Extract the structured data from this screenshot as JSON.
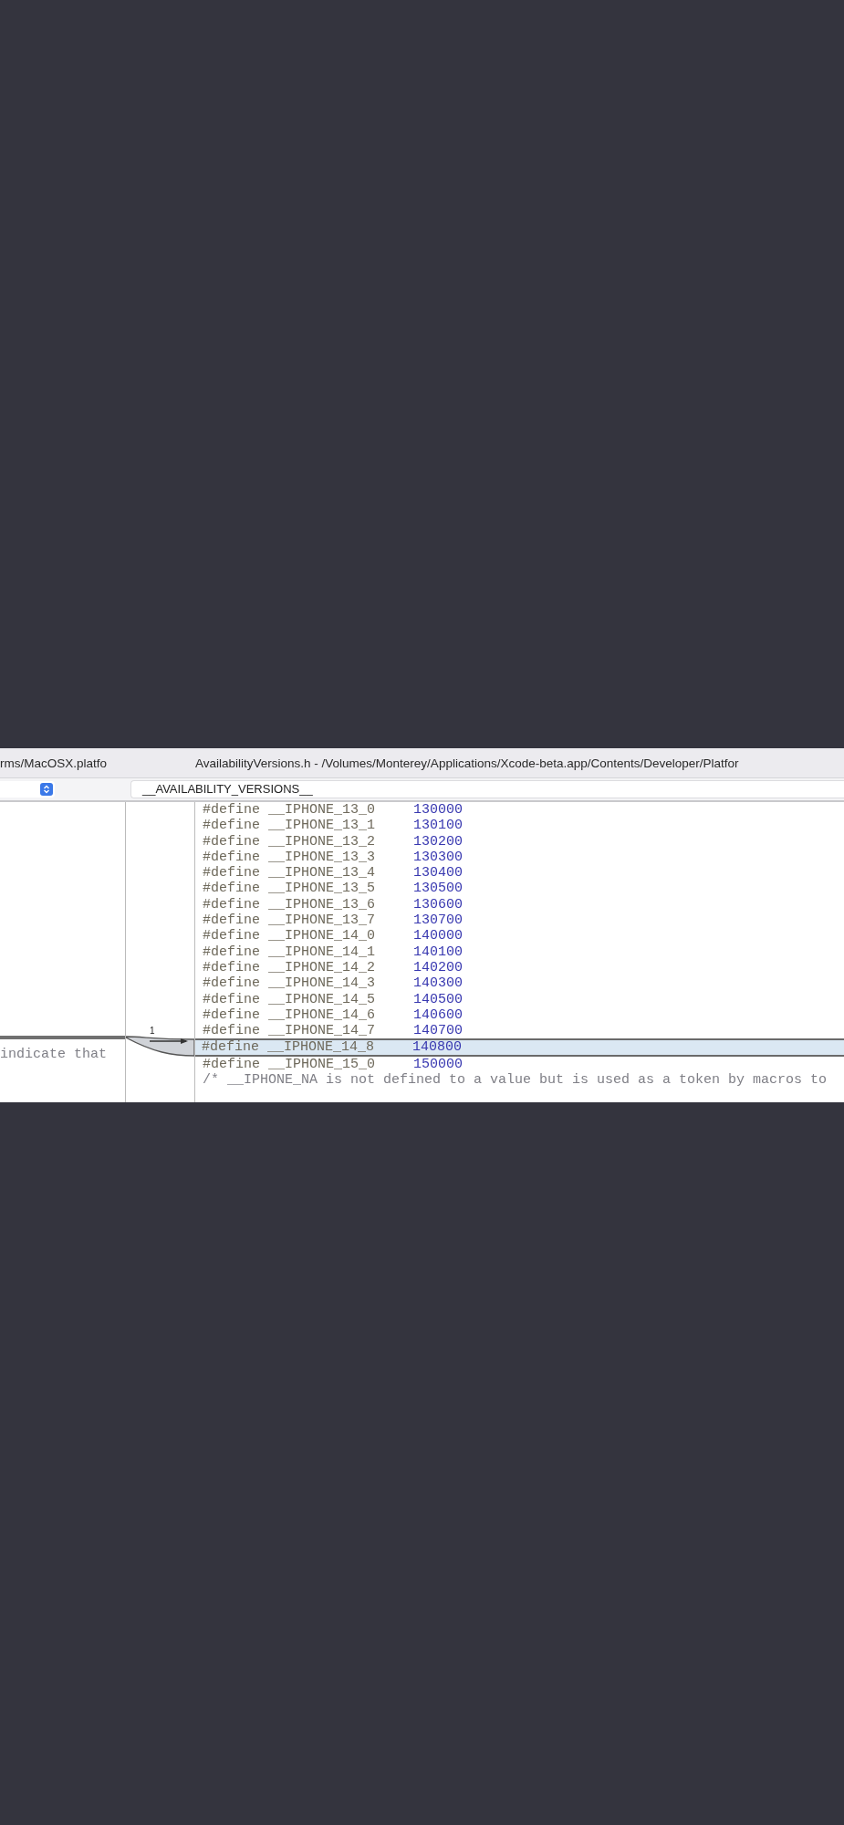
{
  "left_pane": {
    "title": "rms/MacOSX.platfo",
    "lines": [
      {
        "kind": "insertion_marker"
      },
      {
        "kind": "text",
        "text": " indicate that"
      }
    ]
  },
  "gutter": {
    "change_count": "1"
  },
  "right_pane": {
    "title": "AvailabilityVersions.h - /Volumes/Monterey/Applications/Xcode-beta.app/Contents/Developer/Platfor",
    "jump_bar": "__AVAILABILITY_VERSIONS__",
    "lines": [
      {
        "kind": "define",
        "keyword": "#define",
        "name": "__IPHONE_13_0",
        "value": "130000",
        "selected": false
      },
      {
        "kind": "define",
        "keyword": "#define",
        "name": "__IPHONE_13_1",
        "value": "130100",
        "selected": false
      },
      {
        "kind": "define",
        "keyword": "#define",
        "name": "__IPHONE_13_2",
        "value": "130200",
        "selected": false
      },
      {
        "kind": "define",
        "keyword": "#define",
        "name": "__IPHONE_13_3",
        "value": "130300",
        "selected": false
      },
      {
        "kind": "define",
        "keyword": "#define",
        "name": "__IPHONE_13_4",
        "value": "130400",
        "selected": false
      },
      {
        "kind": "define",
        "keyword": "#define",
        "name": "__IPHONE_13_5",
        "value": "130500",
        "selected": false
      },
      {
        "kind": "define",
        "keyword": "#define",
        "name": "__IPHONE_13_6",
        "value": "130600",
        "selected": false
      },
      {
        "kind": "define",
        "keyword": "#define",
        "name": "__IPHONE_13_7",
        "value": "130700",
        "selected": false
      },
      {
        "kind": "define",
        "keyword": "#define",
        "name": "__IPHONE_14_0",
        "value": "140000",
        "selected": false
      },
      {
        "kind": "define",
        "keyword": "#define",
        "name": "__IPHONE_14_1",
        "value": "140100",
        "selected": false
      },
      {
        "kind": "define",
        "keyword": "#define",
        "name": "__IPHONE_14_2",
        "value": "140200",
        "selected": false
      },
      {
        "kind": "define",
        "keyword": "#define",
        "name": "__IPHONE_14_3",
        "value": "140300",
        "selected": false
      },
      {
        "kind": "define",
        "keyword": "#define",
        "name": "__IPHONE_14_5",
        "value": "140500",
        "selected": false
      },
      {
        "kind": "define",
        "keyword": "#define",
        "name": "__IPHONE_14_6",
        "value": "140600",
        "selected": false
      },
      {
        "kind": "define",
        "keyword": "#define",
        "name": "__IPHONE_14_7",
        "value": "140700",
        "selected": false
      },
      {
        "kind": "define",
        "keyword": "#define",
        "name": "__IPHONE_14_8",
        "value": "140800",
        "selected": true
      },
      {
        "kind": "define",
        "keyword": "#define",
        "name": "__IPHONE_15_0",
        "value": "150000",
        "selected": false
      },
      {
        "kind": "comment",
        "text": "/* __IPHONE_NA is not defined to a value but is used as a token by macros to"
      }
    ]
  }
}
